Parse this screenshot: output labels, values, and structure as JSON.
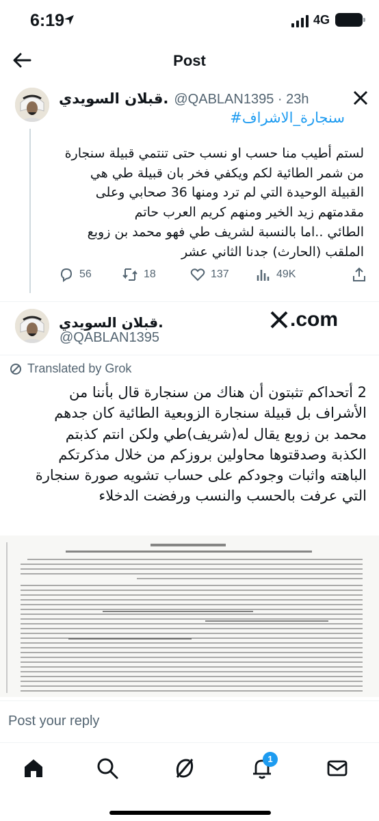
{
  "status_bar": {
    "time": "6:19",
    "network": "4G"
  },
  "header": {
    "title": "Post"
  },
  "tweet": {
    "author_name": "قبلان السويدي.",
    "handle_time": "@QABLAN1395 · 23h",
    "hashtag": "#سنجارة_الاشراف",
    "text": "لستم أطيب منا حسب او نسب حتى  تنتمي قبيلة سنجارة\nمن شمر الطائية لكم ويكفي فخر بان قبيلة طي هي\nالقبيلة الوحيدة التي لم ترد ومنها 36 صحابي وعلى\nمقدمتهم زيد الخير  ومنهم كريم العرب  حاتم\nالطائي ..اما بالنسبة لشريف طي فهو محمد بن زوبع\nالملقب (الحارث) جدنا الثاني عشر",
    "stats": {
      "replies": "56",
      "reposts": "18",
      "likes": "137",
      "views": "49K"
    }
  },
  "quoted": {
    "author_name": "قبلان السويدي.",
    "handle": "@QABLAN1395",
    "site": ".com",
    "translated_label": "Translated by Grok",
    "text": "2 أتحداكم تثبتون أن هناك من سنجارة قال بأننا من\nالأشراف بل قبيلة سنجارة الزوبعية الطائية كان جدهم\nمحمد بن زوبع   يقال له(شريف)طي ولكن انتم كذبتم\nالكذبة وصدقتوها محاولين بروزكم من خلال مذكرتكم\nالباهته واثبات وجودكم على حساب تشويه صورة سنجارة\nالتي عرفت بالحسب والنسب ورفضت الدخلاء"
  },
  "reply": {
    "placeholder": "Post your reply"
  },
  "bottom_nav": {
    "notifications_badge": "1"
  },
  "colors": {
    "accent": "#1d9bf0",
    "muted": "#536471",
    "text": "#0f1419"
  },
  "icons": [
    "back-arrow-icon",
    "x-logo-icon",
    "reply-icon",
    "repost-icon",
    "like-icon",
    "views-icon",
    "share-icon",
    "translate-icon",
    "home-icon",
    "search-icon",
    "grok-icon",
    "notifications-icon",
    "messages-icon"
  ]
}
